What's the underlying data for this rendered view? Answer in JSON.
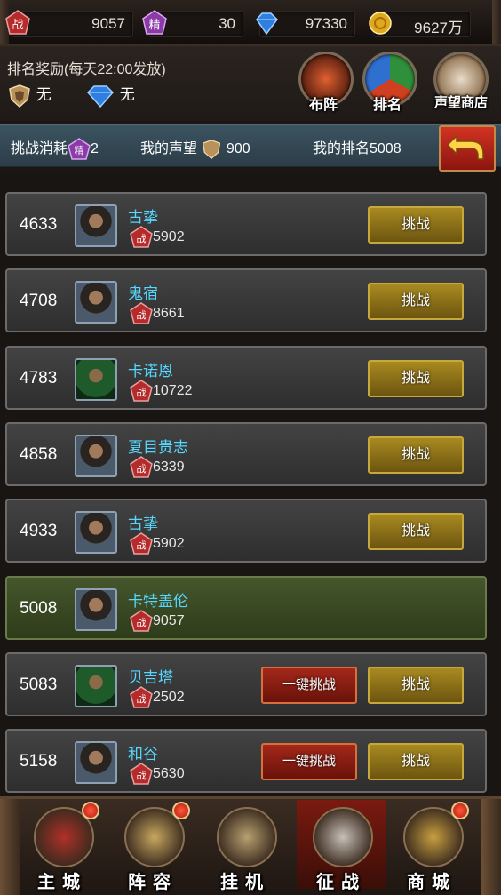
{
  "resources": [
    {
      "icon": "battle-power-icon",
      "glyph": "战",
      "value": "9057"
    },
    {
      "icon": "spirit-icon",
      "glyph": "精",
      "value": "30"
    },
    {
      "icon": "diamond-icon",
      "value": "97330"
    },
    {
      "icon": "gold-coin-icon",
      "value": "9627万"
    }
  ],
  "reward": {
    "title": "排名奖励(每天22:00发放)",
    "items": [
      {
        "icon": "reputation-shield-icon",
        "text": "无"
      },
      {
        "icon": "diamond-icon",
        "text": "无"
      }
    ]
  },
  "top_buttons": [
    {
      "label": "布阵",
      "icon": "formation-icon"
    },
    {
      "label": "排名",
      "icon": "ranking-icon"
    },
    {
      "label": "声望商店",
      "icon": "reputation-shop-icon"
    }
  ],
  "status": {
    "cost_label": "挑战消耗",
    "cost_glyph": "精",
    "cost_value": "2",
    "rep_label": "我的声望",
    "rep_value": "900",
    "rank_label": "我的排名5008"
  },
  "power_glyph": "战",
  "rows": [
    {
      "rank": "4633",
      "name": "古挚",
      "power": "5902",
      "avatar": "warrior",
      "me": false,
      "quick": false
    },
    {
      "rank": "4708",
      "name": "鬼宿",
      "power": "8661",
      "avatar": "warrior",
      "me": false,
      "quick": false
    },
    {
      "rank": "4783",
      "name": "卡诺恩",
      "power": "10722",
      "avatar": "hooded",
      "me": false,
      "quick": false
    },
    {
      "rank": "4858",
      "name": "夏目贵志",
      "power": "6339",
      "avatar": "warrior",
      "me": false,
      "quick": false
    },
    {
      "rank": "4933",
      "name": "古挚",
      "power": "5902",
      "avatar": "warrior",
      "me": false,
      "quick": false
    },
    {
      "rank": "5008",
      "name": "卡特盖伦",
      "power": "9057",
      "avatar": "warrior",
      "me": true,
      "quick": false
    },
    {
      "rank": "5083",
      "name": "贝吉塔",
      "power": "2502",
      "avatar": "hooded",
      "me": false,
      "quick": true
    },
    {
      "rank": "5158",
      "name": "和谷",
      "power": "5630",
      "avatar": "warrior",
      "me": false,
      "quick": true
    }
  ],
  "labels": {
    "challenge": "挑战",
    "quick_challenge": "一键挑战"
  },
  "nav": [
    {
      "label": "主城",
      "icon": "main-city-icon",
      "badge": true,
      "active": false
    },
    {
      "label": "阵容",
      "icon": "lineup-icon",
      "badge": true,
      "active": false
    },
    {
      "label": "挂机",
      "icon": "idle-icon",
      "badge": false,
      "active": false
    },
    {
      "label": "征战",
      "icon": "campaign-icon",
      "badge": false,
      "active": true
    },
    {
      "label": "商城",
      "icon": "mall-icon",
      "badge": true,
      "active": false
    }
  ],
  "colors": {
    "name": "#56d7ff",
    "challenge_gold": "#a88a20",
    "quick_red": "#a3281a",
    "self_row": "#45562c"
  }
}
